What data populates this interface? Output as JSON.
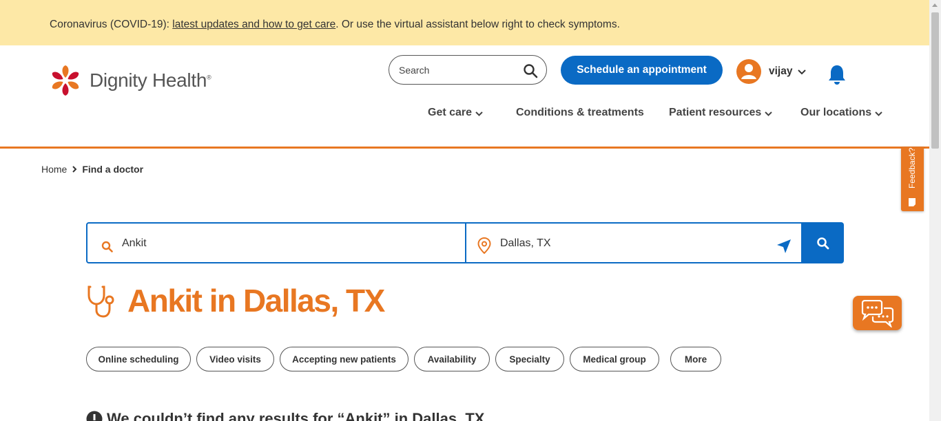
{
  "banner": {
    "prefix": "Coronavirus (COVID-19): ",
    "link": "latest updates and how to get care",
    "suffix": ". Or use the virtual assistant below right to check symptoms."
  },
  "header": {
    "logo_text": "Dignity Health",
    "search_placeholder": "Search",
    "schedule_label": "Schedule an appointment",
    "user_name": "vijay",
    "nav": [
      {
        "label": "Get care",
        "has_dropdown": true
      },
      {
        "label": "Conditions & treatments",
        "has_dropdown": false
      },
      {
        "label": "Patient resources",
        "has_dropdown": true
      },
      {
        "label": "Our locations",
        "has_dropdown": true
      }
    ]
  },
  "breadcrumb": {
    "home": "Home",
    "current": "Find a doctor"
  },
  "feedback_label": "Feedback?",
  "finder": {
    "query": "Ankit",
    "location": "Dallas, TX"
  },
  "results": {
    "title": "Ankit in Dallas, TX",
    "no_results": "We couldn’t find any results for “Ankit” in Dallas, TX"
  },
  "filters": [
    "Online scheduling",
    "Video visits",
    "Accepting new patients",
    "Availability",
    "Specialty",
    "Medical group",
    "More"
  ],
  "colors": {
    "accent_orange": "#e87722",
    "primary_blue": "#0a6ac4",
    "banner_yellow": "#fde8a6"
  },
  "icons": [
    "search-icon",
    "user-avatar-icon",
    "bell-icon",
    "chevron-down-icon",
    "map-pin-icon",
    "locate-arrow-icon",
    "stethoscope-icon",
    "chat-icon",
    "info-icon"
  ]
}
